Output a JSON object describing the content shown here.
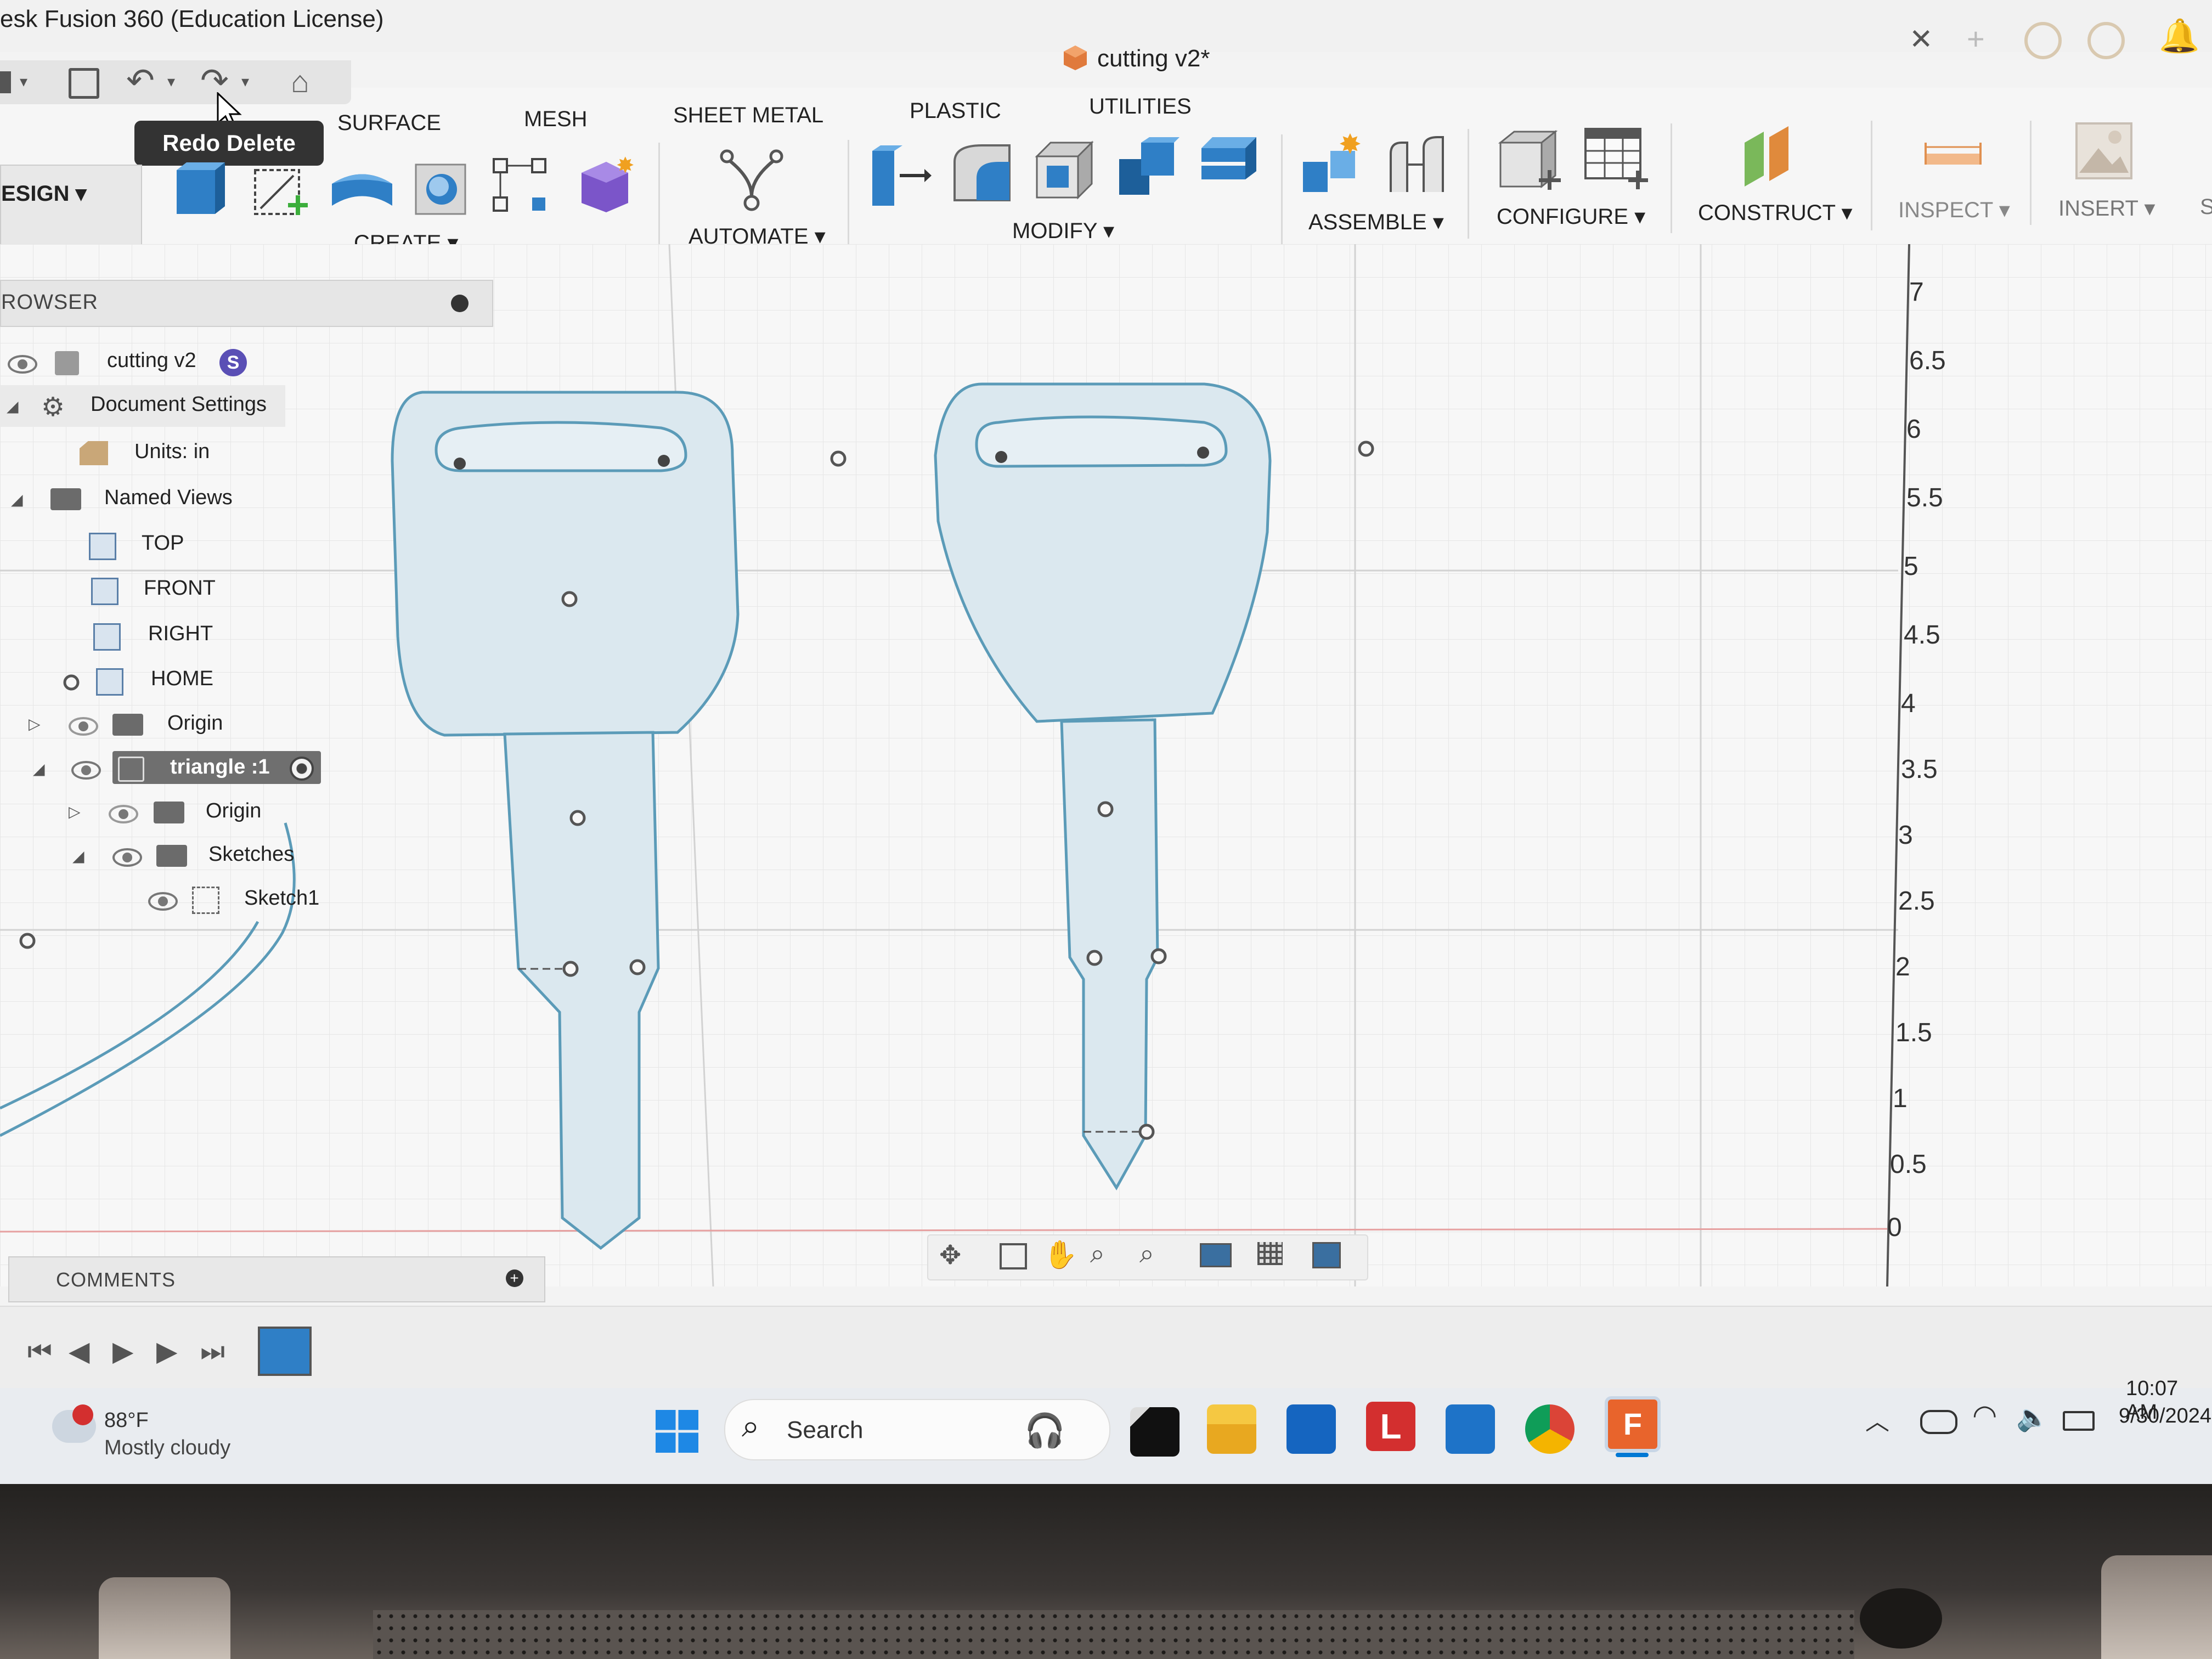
{
  "window": {
    "app_title": "esk Fusion 360 (Education License)",
    "document_title": "cutting v2*"
  },
  "tooltip": {
    "text": "Redo Delete"
  },
  "tabs": [
    "SURFACE",
    "MESH",
    "SHEET METAL",
    "PLASTIC",
    "UTILITIES"
  ],
  "workspace": {
    "label": "ESIGN ▾"
  },
  "groups": {
    "create": "CREATE ▾",
    "automate": "AUTOMATE ▾",
    "modify": "MODIFY ▾",
    "assemble": "ASSEMBLE ▾",
    "configure": "CONFIGURE ▾",
    "construct": "CONSTRUCT ▾",
    "inspect": "INSPECT ▾",
    "insert": "INSERT ▾",
    "select_partial": "S"
  },
  "browser": {
    "header": "ROWSER",
    "items": [
      {
        "label": "cutting v2"
      },
      {
        "label": "Document Settings"
      },
      {
        "label": "Units: in"
      },
      {
        "label": "Named Views"
      },
      {
        "label": "TOP"
      },
      {
        "label": "FRONT"
      },
      {
        "label": "RIGHT"
      },
      {
        "label": "HOME"
      },
      {
        "label": "Origin"
      },
      {
        "label": "triangle :1"
      },
      {
        "label": "Origin"
      },
      {
        "label": "Sketches"
      },
      {
        "label": "Sketch1"
      }
    ]
  },
  "ruler": {
    "labels": [
      "7",
      "6.5",
      "6",
      "5.5",
      "5",
      "4.5",
      "4",
      "3.5",
      "3",
      "2.5",
      "2",
      "1.5",
      "1",
      "0.5",
      "0"
    ]
  },
  "comments": {
    "label": "COMMENTS"
  },
  "taskbar": {
    "weather_temp": "88°F",
    "weather_desc": "Mostly cloudy",
    "search_placeholder": "Search",
    "time": "10:07 AM",
    "date": "9/30/2024"
  },
  "colors": {
    "sketch_stroke": "#5b9bb8",
    "sketch_fill": "#dbe8ef",
    "accent": "#0078d4",
    "tooltip_bg": "#333333"
  }
}
